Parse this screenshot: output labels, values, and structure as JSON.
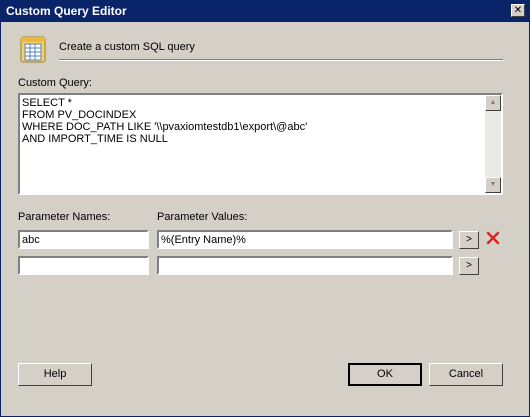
{
  "window": {
    "title": "Custom Query Editor",
    "close_glyph": "✕"
  },
  "header": {
    "icon": "database-icon",
    "text": "Create a custom SQL query"
  },
  "query": {
    "label": "Custom Query:",
    "text": "SELECT *\nFROM PV_DOCINDEX\nWHERE DOC_PATH LIKE '\\\\pvaxiomtestdb1\\export\\@abc'\nAND IMPORT_TIME IS NULL"
  },
  "params": {
    "names_label": "Parameter Names:",
    "values_label": "Parameter Values:",
    "rows": [
      {
        "name": "abc",
        "value": "%(Entry Name)%",
        "button": ">"
      },
      {
        "name": "",
        "value": "",
        "button": ">"
      }
    ]
  },
  "buttons": {
    "help": "Help",
    "ok": "OK",
    "cancel": "Cancel"
  },
  "colors": {
    "titlebar": "#0a246a",
    "face": "#d4d0c8",
    "delete_red": "#e02020"
  }
}
